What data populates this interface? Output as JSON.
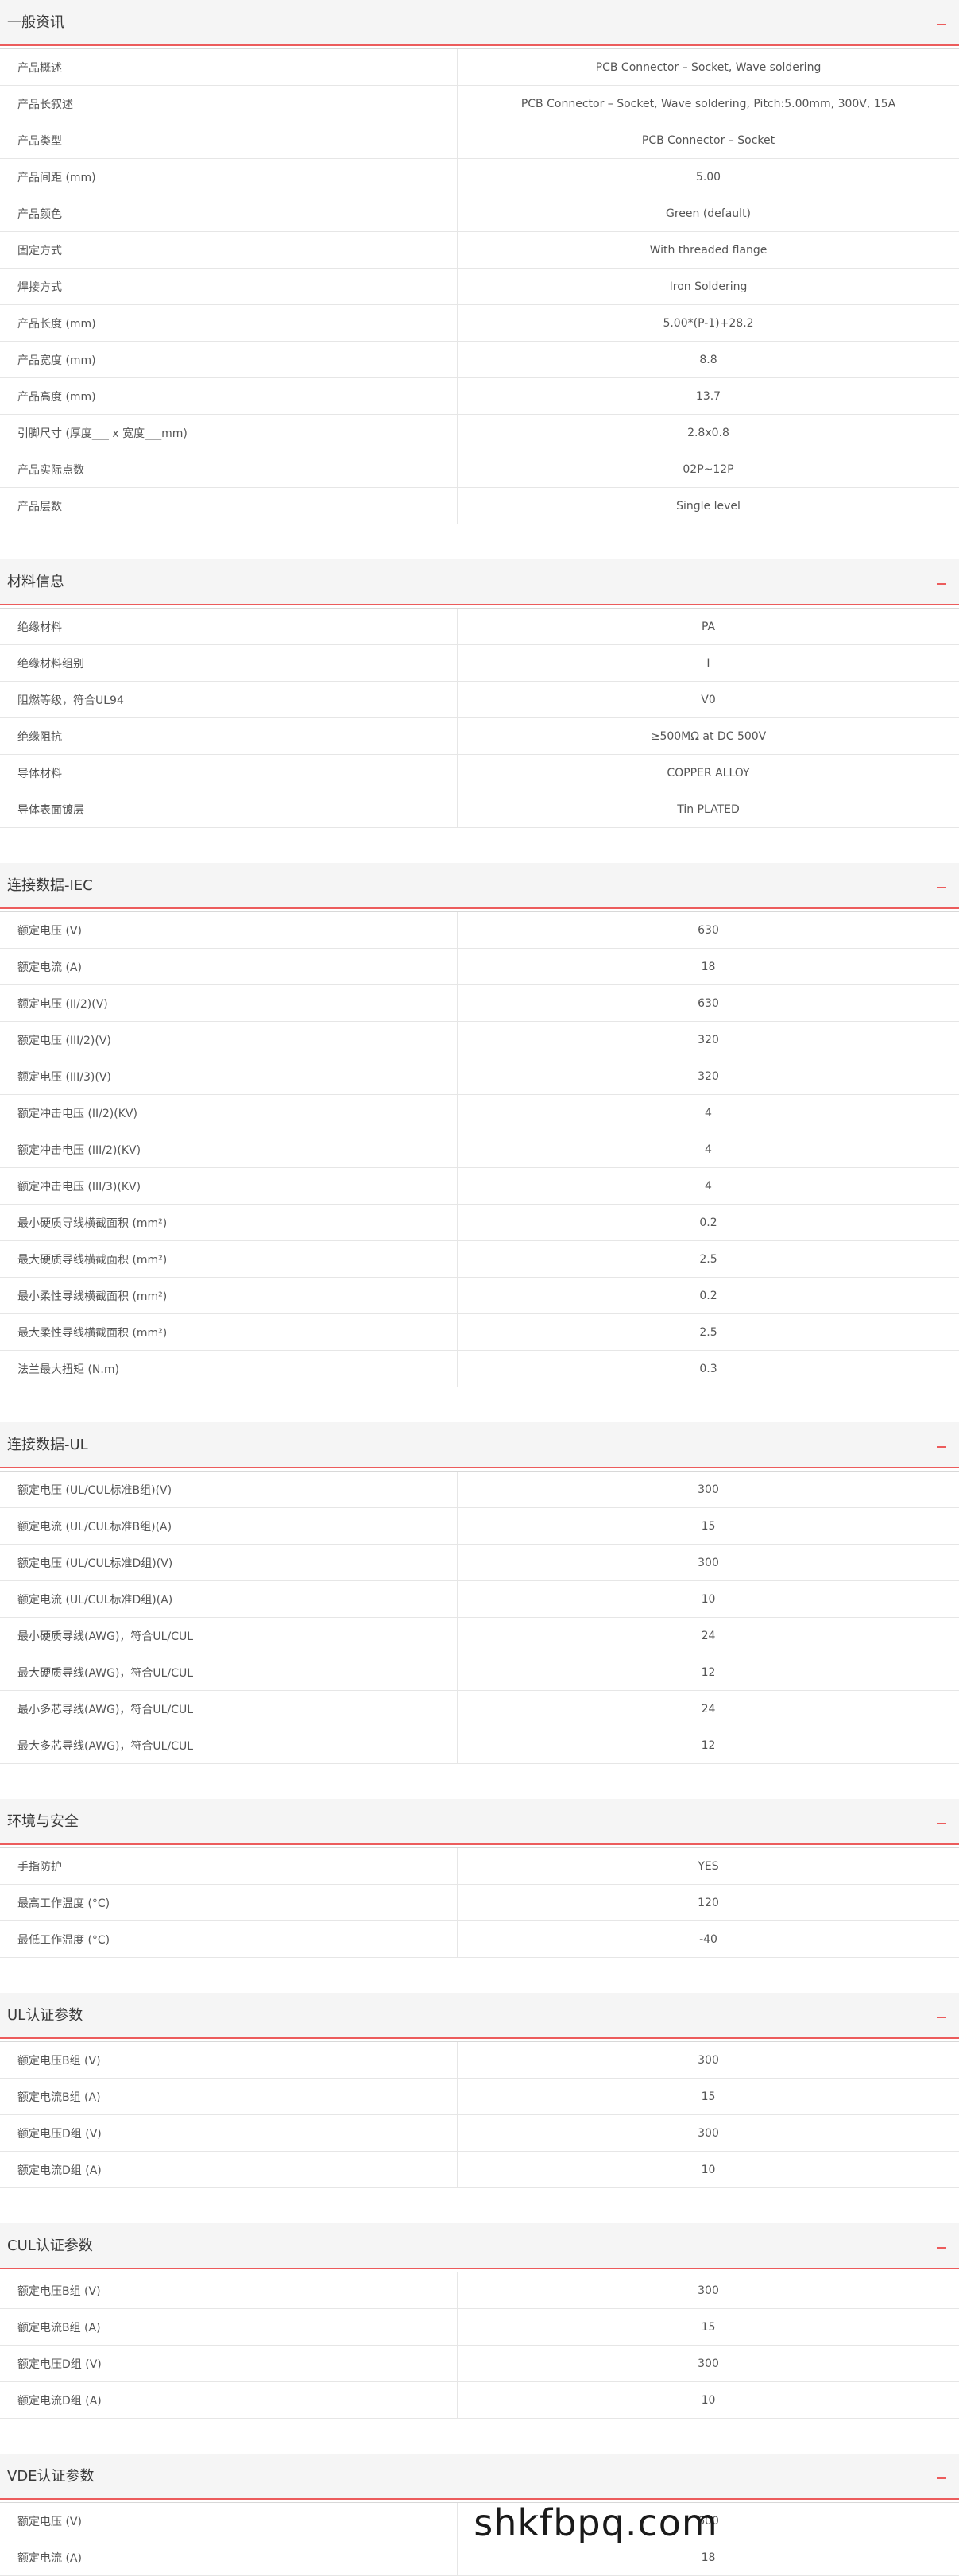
{
  "sections": [
    {
      "title": "一般资讯",
      "rows": [
        {
          "label": "产品概述",
          "value": "PCB Connector – Socket, Wave soldering"
        },
        {
          "label": "产品长叙述",
          "value": "PCB Connector – Socket, Wave soldering, Pitch:5.00mm, 300V, 15A"
        },
        {
          "label": "产品类型",
          "value": "PCB Connector – Socket"
        },
        {
          "label": "产品间距 (mm)",
          "value": "5.00"
        },
        {
          "label": "产品颜色",
          "value": "Green (default)"
        },
        {
          "label": "固定方式",
          "value": "With threaded flange"
        },
        {
          "label": "焊接方式",
          "value": "Iron Soldering"
        },
        {
          "label": "产品长度 (mm)",
          "value": "5.00*(P-1)+28.2"
        },
        {
          "label": "产品宽度 (mm)",
          "value": "8.8"
        },
        {
          "label": "产品高度 (mm)",
          "value": "13.7"
        },
        {
          "label": "引脚尺寸 (厚度___ x 宽度___mm)",
          "value": "2.8x0.8"
        },
        {
          "label": "产品实际点数",
          "value": "02P~12P"
        },
        {
          "label": "产品层数",
          "value": "Single level"
        }
      ]
    },
    {
      "title": "材料信息",
      "rows": [
        {
          "label": "绝缘材料",
          "value": "PA"
        },
        {
          "label": "绝缘材料组别",
          "value": "I"
        },
        {
          "label": "阻燃等级，符合UL94",
          "value": "V0"
        },
        {
          "label": "绝缘阻抗",
          "value": "≥500MΩ at DC 500V"
        },
        {
          "label": "导体材料",
          "value": "COPPER ALLOY"
        },
        {
          "label": "导体表面镀层",
          "value": "Tin PLATED"
        }
      ]
    },
    {
      "title": "连接数据-IEC",
      "rows": [
        {
          "label": "额定电压 (V)",
          "value": "630"
        },
        {
          "label": "额定电流 (A)",
          "value": "18"
        },
        {
          "label": "额定电压 (II/2)(V)",
          "value": "630"
        },
        {
          "label": "额定电压 (III/2)(V)",
          "value": "320"
        },
        {
          "label": "额定电压 (III/3)(V)",
          "value": "320"
        },
        {
          "label": "额定冲击电压 (II/2)(KV)",
          "value": "4"
        },
        {
          "label": "额定冲击电压 (III/2)(KV)",
          "value": "4"
        },
        {
          "label": "额定冲击电压 (III/3)(KV)",
          "value": "4"
        },
        {
          "label": "最小硬质导线横截面积 (mm²)",
          "value": "0.2"
        },
        {
          "label": "最大硬质导线横截面积 (mm²)",
          "value": "2.5"
        },
        {
          "label": "最小柔性导线横截面积 (mm²)",
          "value": "0.2"
        },
        {
          "label": "最大柔性导线横截面积 (mm²)",
          "value": "2.5"
        },
        {
          "label": "法兰最大扭矩 (N.m)",
          "value": "0.3"
        }
      ]
    },
    {
      "title": "连接数据-UL",
      "rows": [
        {
          "label": "额定电压 (UL/CUL标准B组)(V)",
          "value": "300"
        },
        {
          "label": "额定电流 (UL/CUL标准B组)(A)",
          "value": "15"
        },
        {
          "label": "额定电压 (UL/CUL标准D组)(V)",
          "value": "300"
        },
        {
          "label": "额定电流 (UL/CUL标准D组)(A)",
          "value": "10"
        },
        {
          "label": "最小硬质导线(AWG)，符合UL/CUL",
          "value": "24"
        },
        {
          "label": "最大硬质导线(AWG)，符合UL/CUL",
          "value": "12"
        },
        {
          "label": "最小多芯导线(AWG)，符合UL/CUL",
          "value": "24"
        },
        {
          "label": "最大多芯导线(AWG)，符合UL/CUL",
          "value": "12"
        }
      ]
    },
    {
      "title": "环境与安全",
      "rows": [
        {
          "label": "手指防护",
          "value": "YES"
        },
        {
          "label": "最高工作温度 (°C)",
          "value": "120"
        },
        {
          "label": "最低工作温度 (°C)",
          "value": "-40"
        }
      ]
    },
    {
      "title": "UL认证参数",
      "rows": [
        {
          "label": "额定电压B组 (V)",
          "value": "300"
        },
        {
          "label": "额定电流B组 (A)",
          "value": "15"
        },
        {
          "label": "额定电压D组 (V)",
          "value": "300"
        },
        {
          "label": "额定电流D组 (A)",
          "value": "10"
        }
      ]
    },
    {
      "title": "CUL认证参数",
      "rows": [
        {
          "label": "额定电压B组 (V)",
          "value": "300"
        },
        {
          "label": "额定电流B组 (A)",
          "value": "15"
        },
        {
          "label": "额定电压D组 (V)",
          "value": "300"
        },
        {
          "label": "额定电流D组 (A)",
          "value": "10"
        }
      ]
    },
    {
      "title": "VDE认证参数",
      "rows": [
        {
          "label": "额定电压 (V)",
          "value": "600"
        },
        {
          "label": "额定电流 (A)",
          "value": "18"
        }
      ]
    }
  ],
  "watermark": "shkfbpq.com",
  "colors": {
    "accent": "#ec5c5c",
    "header_bg": "#f5f5f5",
    "border": "#e6e6e6"
  },
  "icons": {
    "collapse": "minus-icon"
  }
}
